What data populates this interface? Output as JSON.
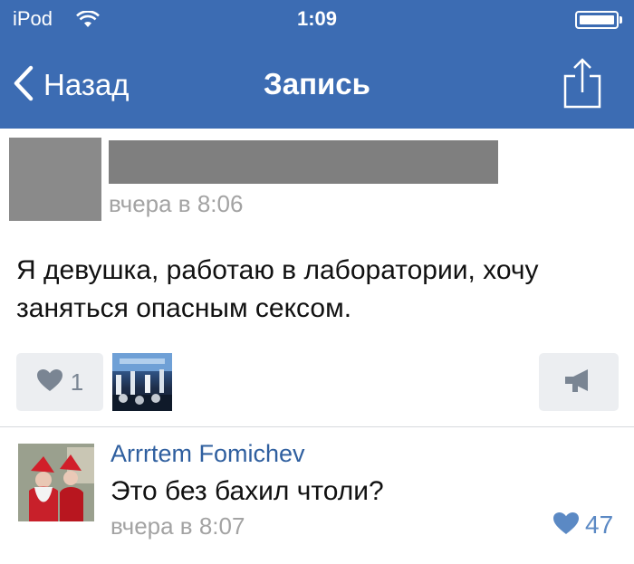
{
  "status_bar": {
    "carrier": "iPod",
    "time": "1:09"
  },
  "nav": {
    "back_label": "Назад",
    "title": "Запись"
  },
  "post": {
    "time": "вчера в 8:06",
    "text": "Я девушка, работаю в лаборатории, хочу заняться опасным сексом.",
    "likes": "1"
  },
  "comment": {
    "author": "Arrrtem Fomichev",
    "text": "Это без бахил чтоли?",
    "time": "вчера в 8:07",
    "likes": "47"
  },
  "colors": {
    "accent": "#3c6cb3",
    "link": "#2f5f9f",
    "muted": "#a3a3a3",
    "button_bg": "#eceef1"
  },
  "icons": [
    "wifi-icon",
    "battery-icon",
    "back-chevron-icon",
    "share-icon",
    "heart-icon",
    "megaphone-icon"
  ]
}
